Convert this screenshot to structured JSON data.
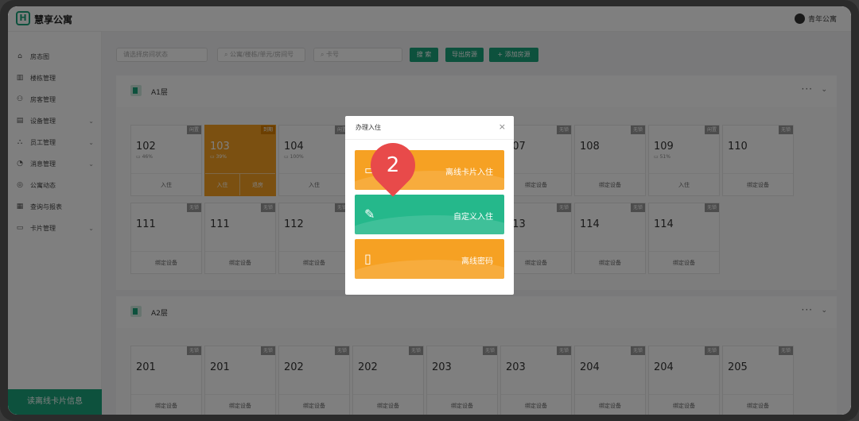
{
  "app": {
    "title": "慧享公寓",
    "logo": "H",
    "user": "青年公寓"
  },
  "sidebar": {
    "items": [
      {
        "icon": "home-icon",
        "label": "房态图"
      },
      {
        "icon": "building-icon",
        "label": "楼栋管理"
      },
      {
        "icon": "user-icon",
        "label": "房客管理"
      },
      {
        "icon": "device-icon",
        "label": "设备管理",
        "expandable": true
      },
      {
        "icon": "staff-icon",
        "label": "员工管理",
        "expandable": true
      },
      {
        "icon": "bell-icon",
        "label": "消息管理",
        "expandable": true
      },
      {
        "icon": "compass-icon",
        "label": "公寓动态"
      },
      {
        "icon": "report-icon",
        "label": "查询与报表"
      },
      {
        "icon": "card-icon",
        "label": "卡片管理",
        "expandable": true
      }
    ],
    "read_card": "读离线卡片信息"
  },
  "filters": {
    "status_placeholder": "请选择房间状态",
    "room_placeholder": "公寓/楼栋/单元/房间号",
    "card_placeholder": "卡号",
    "search": "搜 索",
    "export": "导出房源",
    "add": "+ 添加房源"
  },
  "floors": [
    {
      "name": "A1层",
      "rooms": [
        {
          "num": "102",
          "tag": "闲置",
          "battery": "46%",
          "actions": [
            "入住"
          ]
        },
        {
          "num": "103",
          "tag": "到期",
          "battery": "39%",
          "actions": [
            "入住",
            "退房"
          ],
          "highlight": true
        },
        {
          "num": "104",
          "tag": "闲置",
          "battery": "100%",
          "actions": [
            "入住"
          ]
        },
        {
          "num": "",
          "tag": "",
          "actions": []
        },
        {
          "num": "",
          "tag": "",
          "actions": []
        },
        {
          "num": "107",
          "tag": "无锁",
          "actions": [
            "绑定设备"
          ]
        },
        {
          "num": "108",
          "tag": "无锁",
          "actions": [
            "绑定设备"
          ]
        },
        {
          "num": "109",
          "tag": "闲置",
          "battery": "51%",
          "actions": [
            "入住"
          ]
        },
        {
          "num": "110",
          "tag": "无锁",
          "actions": [
            "绑定设备"
          ]
        },
        {
          "num": "111",
          "tag": "无锁",
          "actions": [
            "绑定设备"
          ]
        },
        {
          "num": "111",
          "tag": "无锁",
          "actions": [
            "绑定设备"
          ]
        },
        {
          "num": "112",
          "tag": "无锁",
          "actions": [
            "绑定设备"
          ]
        },
        {
          "num": "",
          "tag": "",
          "actions": []
        },
        {
          "num": "",
          "tag": "",
          "actions": []
        },
        {
          "num": "113",
          "tag": "无锁",
          "actions": [
            "绑定设备"
          ]
        },
        {
          "num": "114",
          "tag": "无锁",
          "actions": [
            "绑定设备"
          ]
        },
        {
          "num": "114",
          "tag": "无锁",
          "actions": [
            "绑定设备"
          ]
        }
      ]
    },
    {
      "name": "A2层",
      "rooms": [
        {
          "num": "201",
          "tag": "无锁",
          "actions": [
            "绑定设备"
          ]
        },
        {
          "num": "201",
          "tag": "无锁",
          "actions": [
            "绑定设备"
          ]
        },
        {
          "num": "202",
          "tag": "无锁",
          "actions": [
            "绑定设备"
          ]
        },
        {
          "num": "202",
          "tag": "无锁",
          "actions": [
            "绑定设备"
          ]
        },
        {
          "num": "203",
          "tag": "无锁",
          "actions": [
            "绑定设备"
          ]
        },
        {
          "num": "203",
          "tag": "无锁",
          "actions": [
            "绑定设备"
          ]
        },
        {
          "num": "204",
          "tag": "无锁",
          "actions": [
            "绑定设备"
          ]
        },
        {
          "num": "204",
          "tag": "无锁",
          "actions": [
            "绑定设备"
          ]
        },
        {
          "num": "205",
          "tag": "无锁",
          "actions": [
            "绑定设备"
          ]
        }
      ]
    }
  ],
  "modal": {
    "title": "办理入住",
    "close": "×",
    "options": [
      {
        "label": "离线卡片入住",
        "icon": "card-icon"
      },
      {
        "label": "自定义入住",
        "icon": "pencil-icon"
      },
      {
        "label": "离线密码",
        "icon": "lock-icon"
      }
    ]
  },
  "step_marker": "2",
  "colors": {
    "accent": "#1aa37a",
    "orange": "#f6a123",
    "green": "#25b88b",
    "marker": "#e84a4a"
  }
}
